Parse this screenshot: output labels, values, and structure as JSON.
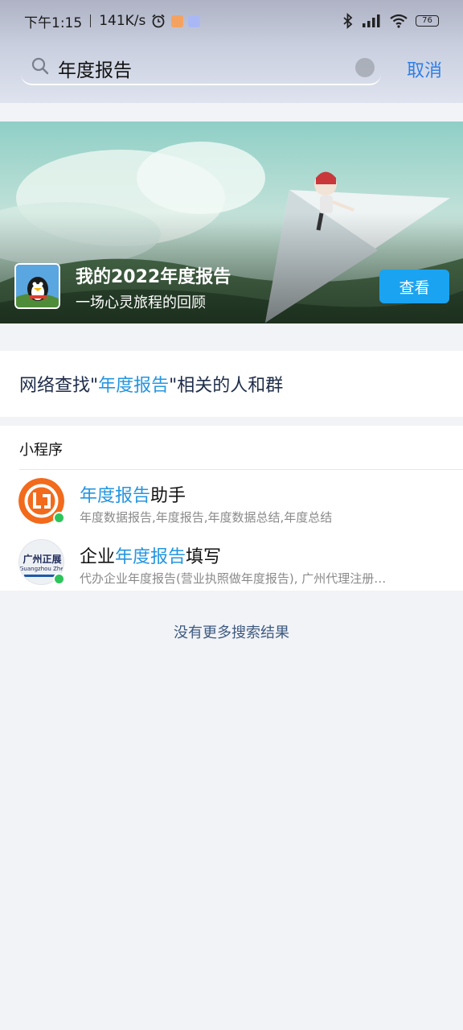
{
  "status_bar": {
    "time": "下午1:15",
    "net_speed": "141K/s",
    "battery": "76",
    "icons": [
      "alarm-icon",
      "mini-app-icon",
      "bell-app-icon",
      "bluetooth-icon",
      "signal-icon",
      "wifi-icon",
      "battery-icon"
    ]
  },
  "search": {
    "query": "年度报告",
    "cancel_label": "取消"
  },
  "banner": {
    "title": "我的2022年度报告",
    "subtitle": "一场心灵旅程的回顾",
    "button_label": "查看"
  },
  "network_search": {
    "prefix": "网络查找\"",
    "keyword": "年度报告",
    "suffix": "\"相关的人和群"
  },
  "mini_programs": {
    "section_title": "小程序",
    "items": [
      {
        "name_highlight": "年度报告",
        "name_suffix": "助手",
        "desc": "年度数据报告,年度报告,年度数据总结,年度总结",
        "icon": "annual-report-assistant-icon"
      },
      {
        "name_prefix": "企业",
        "name_highlight": "年度报告",
        "name_suffix": "填写",
        "desc": "代办企业年度报告(营业执照做年度报告), 广州代理注册…",
        "icon_text": "广州正展",
        "icon_subtext": "Guangzhou Zhen",
        "icon": "guangzhou-zhengzhan-icon"
      }
    ]
  },
  "no_more_results": "没有更多搜索结果",
  "colors": {
    "accent": "#2495e0",
    "cancel": "#2f7fe6",
    "view_button": "#1aa3f0",
    "mini_badge": "#2ec45c"
  }
}
